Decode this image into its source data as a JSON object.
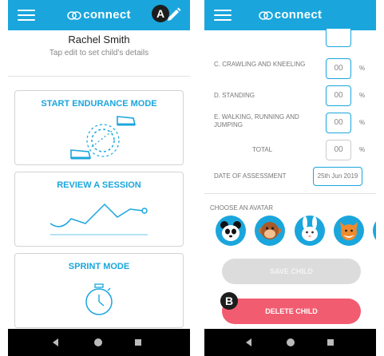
{
  "app": {
    "brand": "connect"
  },
  "markers": {
    "a": "A",
    "b": "B"
  },
  "left_screen": {
    "user_name": "Rachel Smith",
    "hint": "Tap edit to set child's details",
    "cards": [
      {
        "title": "START ENDURANCE MODE",
        "icon": "running-shoes-icon"
      },
      {
        "title": "REVIEW A SESSION",
        "icon": "line-graph-icon"
      },
      {
        "title": "SPRINT MODE",
        "icon": "stopwatch-icon"
      }
    ]
  },
  "right_screen": {
    "rows": [
      {
        "label": "C. CRAWLING AND KNEELING",
        "value": "00",
        "unit": "%"
      },
      {
        "label": "D. STANDING",
        "value": "00",
        "unit": "%"
      },
      {
        "label": "E. WALKING, RUNNING AND JUMPING",
        "value": "00",
        "unit": "%"
      }
    ],
    "total": {
      "label": "TOTAL",
      "value": "00",
      "unit": "%"
    },
    "date": {
      "label": "DATE OF ASSESSMENT",
      "value": "25th Jun 2019"
    },
    "avatar_title": "CHOOSE AN AVATAR",
    "avatars": [
      "panda-avatar",
      "monkey-avatar",
      "rabbit-avatar",
      "fox-avatar",
      "lion-avatar"
    ],
    "save_label": "SAVE CHILD",
    "delete_label": "DELETE CHILD"
  },
  "colors": {
    "primary": "#1aa6dd",
    "delete": "#f25c70",
    "disabled": "#dcdcdc"
  }
}
